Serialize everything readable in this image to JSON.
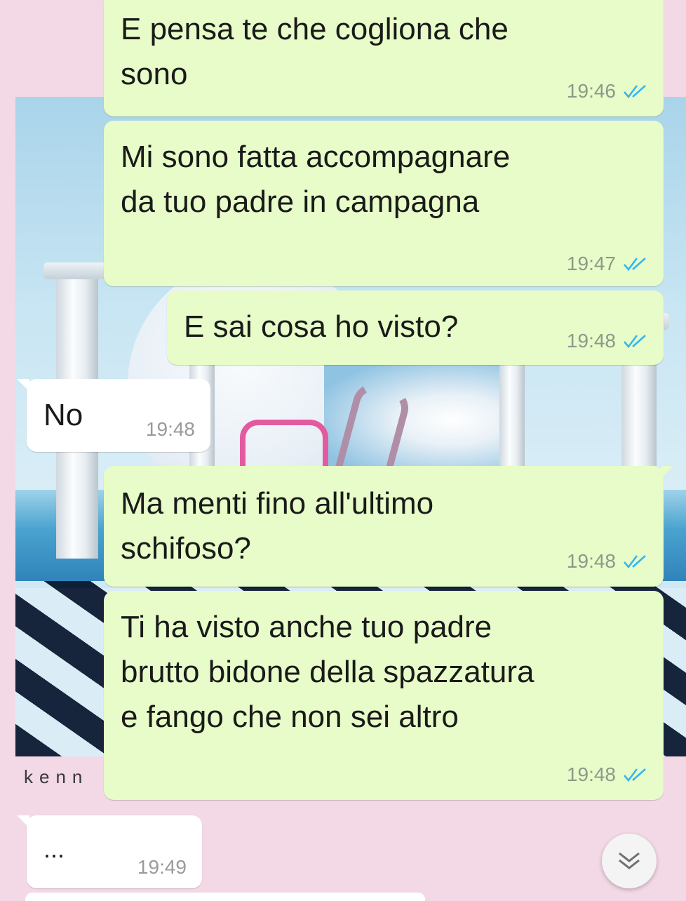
{
  "wallpaper": {
    "label": "kenn"
  },
  "messages": [
    {
      "direction": "out",
      "text": "E pensa te che cogliona che\nsono",
      "time": "19:46",
      "status": "read"
    },
    {
      "direction": "out",
      "text": "Mi sono fatta accompagnare\nda tuo padre in campagna",
      "time": "19:47",
      "status": "read"
    },
    {
      "direction": "out",
      "text": "E sai cosa ho visto?",
      "time": "19:48",
      "status": "read"
    },
    {
      "direction": "in",
      "text": "No",
      "time": "19:48"
    },
    {
      "direction": "out",
      "text": "Ma menti fino all'ultimo\nschifoso?",
      "time": "19:48",
      "status": "read"
    },
    {
      "direction": "out",
      "text": "Ti ha visto anche tuo padre\nbrutto bidone della spazzatura\ne fango che non sei altro",
      "time": "19:48",
      "status": "read"
    },
    {
      "direction": "in",
      "text": "...",
      "time": "19:49"
    }
  ],
  "colors": {
    "outgoing_bubble": "#e7fcc8",
    "incoming_bubble": "#ffffff",
    "read_ticks": "#34b7f1",
    "background": "#f3d8e6"
  },
  "icons": {
    "read_receipt": "double-check-icon",
    "scroll_down": "chevron-down-double-icon"
  }
}
